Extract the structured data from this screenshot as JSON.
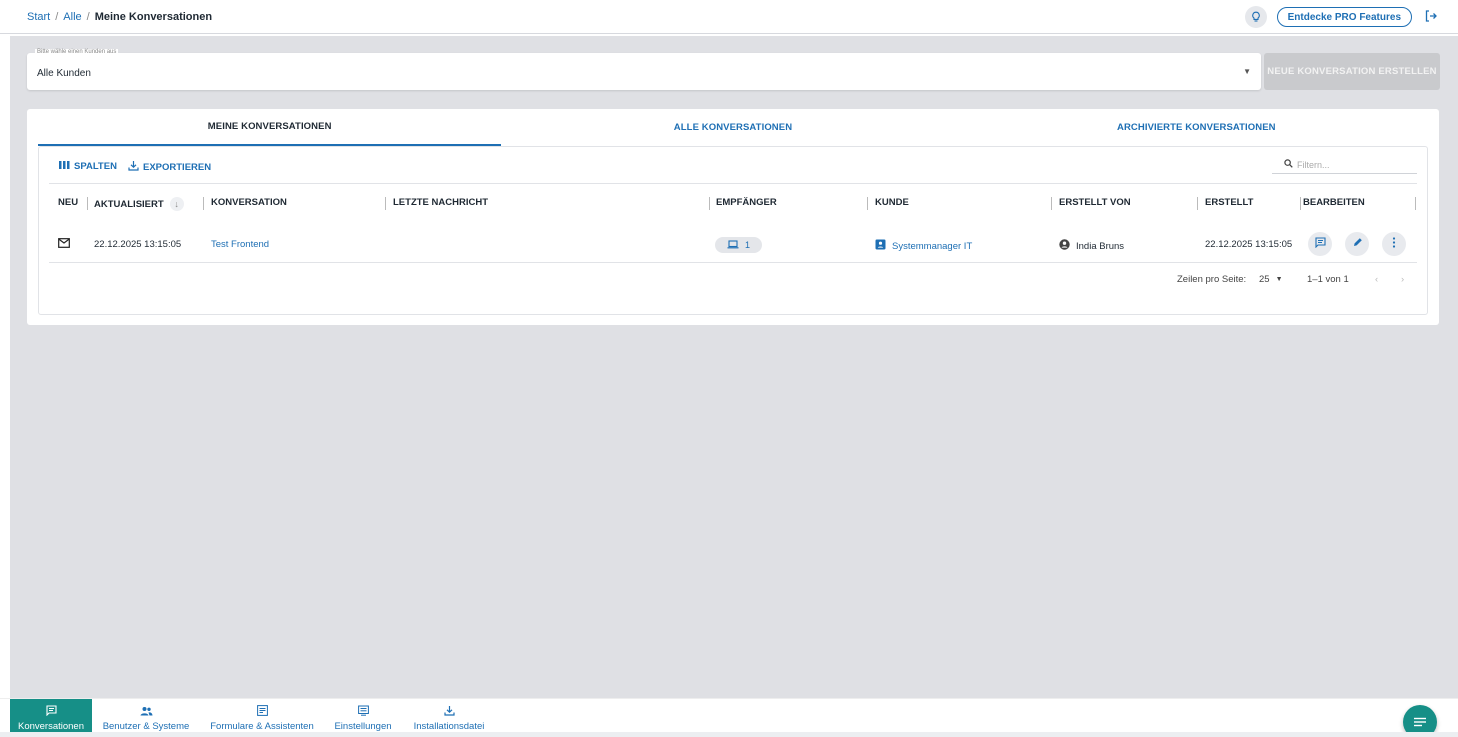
{
  "breadcrumb": {
    "start": "Start",
    "sep1": "/",
    "all": "Alle",
    "sep2": "/",
    "current": "Meine Konversationen"
  },
  "topbar": {
    "pro_label": "Entdecke PRO Features",
    "bulb_icon": "lightbulb-icon",
    "logout_icon": "logout-icon"
  },
  "customer_select": {
    "legend": "Bitte wähle einen Kunden aus",
    "value": "Alle Kunden"
  },
  "new_conversation_label": "NEUE KONVERSATION ERSTELLEN",
  "tabs": [
    {
      "label": "MEINE KONVERSATIONEN",
      "active": true
    },
    {
      "label": "ALLE KONVERSATIONEN",
      "active": false
    },
    {
      "label": "ARCHIVIERTE KONVERSATIONEN",
      "active": false
    }
  ],
  "toolbar": {
    "columns_label": "SPALTEN",
    "export_label": "EXPORTIEREN",
    "filter_placeholder": "Filtern..."
  },
  "columns": [
    "NEU",
    "AKTUALISIERT",
    "KONVERSATION",
    "LETZTE NACHRICHT",
    "EMPFÄNGER",
    "KUNDE",
    "ERSTELLT VON",
    "ERSTELLT",
    "BEARBEITEN"
  ],
  "rows": [
    {
      "updated": "22.12.2025 13:15:05",
      "conversation": "Test Frontend",
      "last_message": "",
      "recipients": "1",
      "customer": "Systemmanager IT",
      "created_by": "India Bruns",
      "created": "22.12.2025 13:15:05"
    }
  ],
  "pagination": {
    "rows_per_page_label": "Zeilen pro Seite:",
    "rows_per_page": "25",
    "range": "1–1 von 1"
  },
  "bottom_nav": [
    {
      "label": "Konversationen",
      "icon": "chat-icon",
      "active": true
    },
    {
      "label": "Benutzer & Systeme",
      "icon": "users-icon",
      "active": false
    },
    {
      "label": "Formulare & Assistenten",
      "icon": "form-icon",
      "active": false
    },
    {
      "label": "Einstellungen",
      "icon": "settings-icon",
      "active": false
    },
    {
      "label": "Installationsdatei",
      "icon": "download-icon",
      "active": false
    }
  ],
  "colors": {
    "accent": "#1e6fb4",
    "teal": "#168f87",
    "background": "#dfe0e4",
    "disabled_button": "#c9cacd"
  }
}
